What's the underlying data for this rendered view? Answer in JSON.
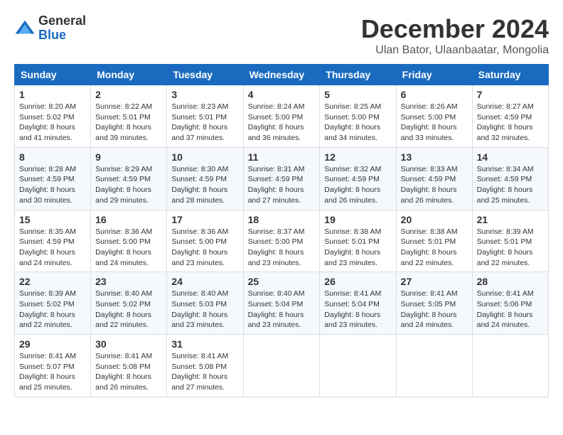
{
  "logo": {
    "general": "General",
    "blue": "Blue"
  },
  "title": "December 2024",
  "subtitle": "Ulan Bator, Ulaanbaatar, Mongolia",
  "days_of_week": [
    "Sunday",
    "Monday",
    "Tuesday",
    "Wednesday",
    "Thursday",
    "Friday",
    "Saturday"
  ],
  "weeks": [
    [
      {
        "day": "1",
        "sunrise": "8:20 AM",
        "sunset": "5:02 PM",
        "daylight": "8 hours and 41 minutes."
      },
      {
        "day": "2",
        "sunrise": "8:22 AM",
        "sunset": "5:01 PM",
        "daylight": "8 hours and 39 minutes."
      },
      {
        "day": "3",
        "sunrise": "8:23 AM",
        "sunset": "5:01 PM",
        "daylight": "8 hours and 37 minutes."
      },
      {
        "day": "4",
        "sunrise": "8:24 AM",
        "sunset": "5:00 PM",
        "daylight": "8 hours and 36 minutes."
      },
      {
        "day": "5",
        "sunrise": "8:25 AM",
        "sunset": "5:00 PM",
        "daylight": "8 hours and 34 minutes."
      },
      {
        "day": "6",
        "sunrise": "8:26 AM",
        "sunset": "5:00 PM",
        "daylight": "8 hours and 33 minutes."
      },
      {
        "day": "7",
        "sunrise": "8:27 AM",
        "sunset": "4:59 PM",
        "daylight": "8 hours and 32 minutes."
      }
    ],
    [
      {
        "day": "8",
        "sunrise": "8:28 AM",
        "sunset": "4:59 PM",
        "daylight": "8 hours and 30 minutes."
      },
      {
        "day": "9",
        "sunrise": "8:29 AM",
        "sunset": "4:59 PM",
        "daylight": "8 hours and 29 minutes."
      },
      {
        "day": "10",
        "sunrise": "8:30 AM",
        "sunset": "4:59 PM",
        "daylight": "8 hours and 28 minutes."
      },
      {
        "day": "11",
        "sunrise": "8:31 AM",
        "sunset": "4:59 PM",
        "daylight": "8 hours and 27 minutes."
      },
      {
        "day": "12",
        "sunrise": "8:32 AM",
        "sunset": "4:59 PM",
        "daylight": "8 hours and 26 minutes."
      },
      {
        "day": "13",
        "sunrise": "8:33 AM",
        "sunset": "4:59 PM",
        "daylight": "8 hours and 26 minutes."
      },
      {
        "day": "14",
        "sunrise": "8:34 AM",
        "sunset": "4:59 PM",
        "daylight": "8 hours and 25 minutes."
      }
    ],
    [
      {
        "day": "15",
        "sunrise": "8:35 AM",
        "sunset": "4:59 PM",
        "daylight": "8 hours and 24 minutes."
      },
      {
        "day": "16",
        "sunrise": "8:36 AM",
        "sunset": "5:00 PM",
        "daylight": "8 hours and 24 minutes."
      },
      {
        "day": "17",
        "sunrise": "8:36 AM",
        "sunset": "5:00 PM",
        "daylight": "8 hours and 23 minutes."
      },
      {
        "day": "18",
        "sunrise": "8:37 AM",
        "sunset": "5:00 PM",
        "daylight": "8 hours and 23 minutes."
      },
      {
        "day": "19",
        "sunrise": "8:38 AM",
        "sunset": "5:01 PM",
        "daylight": "8 hours and 23 minutes."
      },
      {
        "day": "20",
        "sunrise": "8:38 AM",
        "sunset": "5:01 PM",
        "daylight": "8 hours and 22 minutes."
      },
      {
        "day": "21",
        "sunrise": "8:39 AM",
        "sunset": "5:01 PM",
        "daylight": "8 hours and 22 minutes."
      }
    ],
    [
      {
        "day": "22",
        "sunrise": "8:39 AM",
        "sunset": "5:02 PM",
        "daylight": "8 hours and 22 minutes."
      },
      {
        "day": "23",
        "sunrise": "8:40 AM",
        "sunset": "5:02 PM",
        "daylight": "8 hours and 22 minutes."
      },
      {
        "day": "24",
        "sunrise": "8:40 AM",
        "sunset": "5:03 PM",
        "daylight": "8 hours and 23 minutes."
      },
      {
        "day": "25",
        "sunrise": "8:40 AM",
        "sunset": "5:04 PM",
        "daylight": "8 hours and 23 minutes."
      },
      {
        "day": "26",
        "sunrise": "8:41 AM",
        "sunset": "5:04 PM",
        "daylight": "8 hours and 23 minutes."
      },
      {
        "day": "27",
        "sunrise": "8:41 AM",
        "sunset": "5:05 PM",
        "daylight": "8 hours and 24 minutes."
      },
      {
        "day": "28",
        "sunrise": "8:41 AM",
        "sunset": "5:06 PM",
        "daylight": "8 hours and 24 minutes."
      }
    ],
    [
      {
        "day": "29",
        "sunrise": "8:41 AM",
        "sunset": "5:07 PM",
        "daylight": "8 hours and 25 minutes."
      },
      {
        "day": "30",
        "sunrise": "8:41 AM",
        "sunset": "5:08 PM",
        "daylight": "8 hours and 26 minutes."
      },
      {
        "day": "31",
        "sunrise": "8:41 AM",
        "sunset": "5:08 PM",
        "daylight": "8 hours and 27 minutes."
      },
      null,
      null,
      null,
      null
    ]
  ]
}
